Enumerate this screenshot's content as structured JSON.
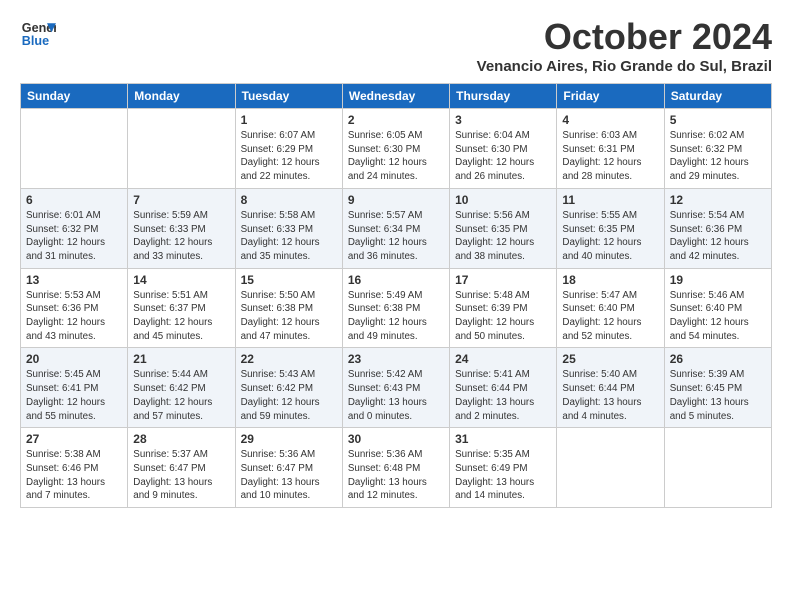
{
  "logo": {
    "line1": "General",
    "line2": "Blue"
  },
  "title": "October 2024",
  "location": "Venancio Aires, Rio Grande do Sul, Brazil",
  "days_of_week": [
    "Sunday",
    "Monday",
    "Tuesday",
    "Wednesday",
    "Thursday",
    "Friday",
    "Saturday"
  ],
  "weeks": [
    [
      {
        "day": "",
        "info": ""
      },
      {
        "day": "",
        "info": ""
      },
      {
        "day": "1",
        "info": "Sunrise: 6:07 AM\nSunset: 6:29 PM\nDaylight: 12 hours\nand 22 minutes."
      },
      {
        "day": "2",
        "info": "Sunrise: 6:05 AM\nSunset: 6:30 PM\nDaylight: 12 hours\nand 24 minutes."
      },
      {
        "day": "3",
        "info": "Sunrise: 6:04 AM\nSunset: 6:30 PM\nDaylight: 12 hours\nand 26 minutes."
      },
      {
        "day": "4",
        "info": "Sunrise: 6:03 AM\nSunset: 6:31 PM\nDaylight: 12 hours\nand 28 minutes."
      },
      {
        "day": "5",
        "info": "Sunrise: 6:02 AM\nSunset: 6:32 PM\nDaylight: 12 hours\nand 29 minutes."
      }
    ],
    [
      {
        "day": "6",
        "info": "Sunrise: 6:01 AM\nSunset: 6:32 PM\nDaylight: 12 hours\nand 31 minutes."
      },
      {
        "day": "7",
        "info": "Sunrise: 5:59 AM\nSunset: 6:33 PM\nDaylight: 12 hours\nand 33 minutes."
      },
      {
        "day": "8",
        "info": "Sunrise: 5:58 AM\nSunset: 6:33 PM\nDaylight: 12 hours\nand 35 minutes."
      },
      {
        "day": "9",
        "info": "Sunrise: 5:57 AM\nSunset: 6:34 PM\nDaylight: 12 hours\nand 36 minutes."
      },
      {
        "day": "10",
        "info": "Sunrise: 5:56 AM\nSunset: 6:35 PM\nDaylight: 12 hours\nand 38 minutes."
      },
      {
        "day": "11",
        "info": "Sunrise: 5:55 AM\nSunset: 6:35 PM\nDaylight: 12 hours\nand 40 minutes."
      },
      {
        "day": "12",
        "info": "Sunrise: 5:54 AM\nSunset: 6:36 PM\nDaylight: 12 hours\nand 42 minutes."
      }
    ],
    [
      {
        "day": "13",
        "info": "Sunrise: 5:53 AM\nSunset: 6:36 PM\nDaylight: 12 hours\nand 43 minutes."
      },
      {
        "day": "14",
        "info": "Sunrise: 5:51 AM\nSunset: 6:37 PM\nDaylight: 12 hours\nand 45 minutes."
      },
      {
        "day": "15",
        "info": "Sunrise: 5:50 AM\nSunset: 6:38 PM\nDaylight: 12 hours\nand 47 minutes."
      },
      {
        "day": "16",
        "info": "Sunrise: 5:49 AM\nSunset: 6:38 PM\nDaylight: 12 hours\nand 49 minutes."
      },
      {
        "day": "17",
        "info": "Sunrise: 5:48 AM\nSunset: 6:39 PM\nDaylight: 12 hours\nand 50 minutes."
      },
      {
        "day": "18",
        "info": "Sunrise: 5:47 AM\nSunset: 6:40 PM\nDaylight: 12 hours\nand 52 minutes."
      },
      {
        "day": "19",
        "info": "Sunrise: 5:46 AM\nSunset: 6:40 PM\nDaylight: 12 hours\nand 54 minutes."
      }
    ],
    [
      {
        "day": "20",
        "info": "Sunrise: 5:45 AM\nSunset: 6:41 PM\nDaylight: 12 hours\nand 55 minutes."
      },
      {
        "day": "21",
        "info": "Sunrise: 5:44 AM\nSunset: 6:42 PM\nDaylight: 12 hours\nand 57 minutes."
      },
      {
        "day": "22",
        "info": "Sunrise: 5:43 AM\nSunset: 6:42 PM\nDaylight: 12 hours\nand 59 minutes."
      },
      {
        "day": "23",
        "info": "Sunrise: 5:42 AM\nSunset: 6:43 PM\nDaylight: 13 hours\nand 0 minutes."
      },
      {
        "day": "24",
        "info": "Sunrise: 5:41 AM\nSunset: 6:44 PM\nDaylight: 13 hours\nand 2 minutes."
      },
      {
        "day": "25",
        "info": "Sunrise: 5:40 AM\nSunset: 6:44 PM\nDaylight: 13 hours\nand 4 minutes."
      },
      {
        "day": "26",
        "info": "Sunrise: 5:39 AM\nSunset: 6:45 PM\nDaylight: 13 hours\nand 5 minutes."
      }
    ],
    [
      {
        "day": "27",
        "info": "Sunrise: 5:38 AM\nSunset: 6:46 PM\nDaylight: 13 hours\nand 7 minutes."
      },
      {
        "day": "28",
        "info": "Sunrise: 5:37 AM\nSunset: 6:47 PM\nDaylight: 13 hours\nand 9 minutes."
      },
      {
        "day": "29",
        "info": "Sunrise: 5:36 AM\nSunset: 6:47 PM\nDaylight: 13 hours\nand 10 minutes."
      },
      {
        "day": "30",
        "info": "Sunrise: 5:36 AM\nSunset: 6:48 PM\nDaylight: 13 hours\nand 12 minutes."
      },
      {
        "day": "31",
        "info": "Sunrise: 5:35 AM\nSunset: 6:49 PM\nDaylight: 13 hours\nand 14 minutes."
      },
      {
        "day": "",
        "info": ""
      },
      {
        "day": "",
        "info": ""
      }
    ]
  ]
}
